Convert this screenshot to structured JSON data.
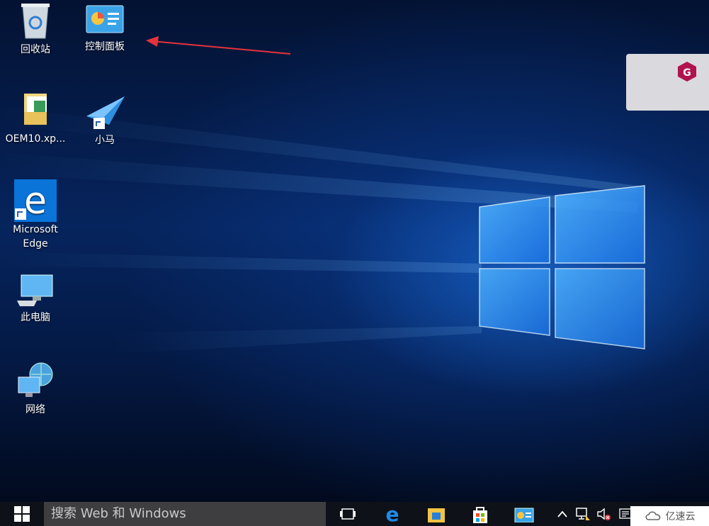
{
  "desktop_icons": {
    "recycle_bin": "回收站",
    "control_panel": "控制面板",
    "oem": "OEM10.xp...",
    "xiaoma": "小马",
    "edge_line1": "Microsoft",
    "edge_line2": "Edge",
    "this_pc": "此电脑",
    "network": "网络"
  },
  "taskbar": {
    "search_placeholder": "搜索 Web 和 Windows"
  },
  "watermark": {
    "text": "亿速云"
  },
  "colors": {
    "accent": "#0a74d8",
    "taskbar": "#0f1118",
    "search_box": "#3e3e40",
    "arrow": "#e8323a"
  }
}
